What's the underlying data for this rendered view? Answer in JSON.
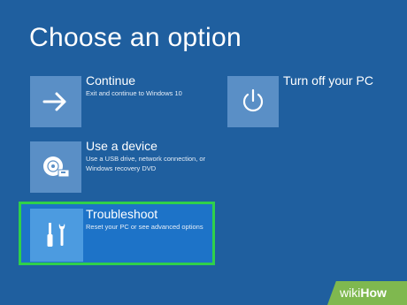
{
  "screen": {
    "title": "Choose an option"
  },
  "options": [
    {
      "label": "Continue",
      "description": "Exit and continue to Windows 10",
      "icon": "arrow-right-icon"
    },
    {
      "label": "Turn off your PC",
      "description": "",
      "icon": "power-icon"
    },
    {
      "label": "Use a device",
      "description": "Use a USB drive, network connection, or Windows recovery DVD",
      "icon": "disc-drive-icon"
    },
    {
      "label": "Troubleshoot",
      "description": "Reset your PC or see advanced options",
      "icon": "tools-icon"
    }
  ],
  "watermark": {
    "wiki": "wiki",
    "how": "How"
  },
  "colors": {
    "background": "#1f5f9f",
    "tile": "#5a8fc6",
    "highlight_border": "#2fd04a",
    "highlight_fill": "#1d73c8",
    "watermark_bg": "#7fb84f"
  }
}
